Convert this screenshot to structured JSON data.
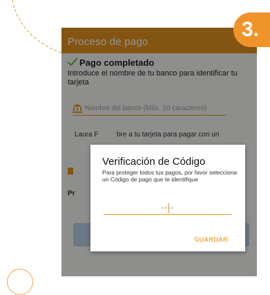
{
  "badge": {
    "step": "3."
  },
  "appbar": {
    "title": "Proceso de pago"
  },
  "status": {
    "text": "Pago completado"
  },
  "instruction": "Introduce el nombre de tu banco para identificar tu tarjeta",
  "bank_field": {
    "placeholder": "Nombre del banco (Máx. 10 caracteres)"
  },
  "background_text": {
    "line1_left": "Laura F",
    "line1_right": "bre a tu tarjeta para pagar con un",
    "left_label": "Pr"
  },
  "dialog": {
    "title": "Verificación de Código",
    "body": "Para proteger todos tus pagos, por favor selecciona un Código de pago que te identifique",
    "code_placeholder": "****",
    "save_label": "GUARDAR"
  },
  "colors": {
    "accent": "#e3931f",
    "badge": "#f0942a",
    "check": "#6cbf4f",
    "save": "#f0a63a"
  },
  "icons": {
    "status": "check-icon",
    "bank": "bank-icon"
  }
}
